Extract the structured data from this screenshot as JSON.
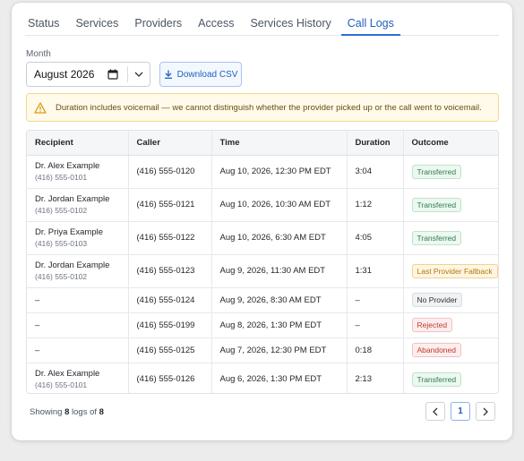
{
  "tabs": [
    {
      "label": "Status"
    },
    {
      "label": "Services"
    },
    {
      "label": "Providers"
    },
    {
      "label": "Access"
    },
    {
      "label": "Services History"
    },
    {
      "label": "Call Logs"
    }
  ],
  "active_tab": "Call Logs",
  "filters": {
    "month_label": "Month",
    "month_value": "August 2026",
    "download_label": "Download CSV"
  },
  "alert": {
    "text": "Duration includes voicemail — we cannot distinguish whether the provider picked up or the call went to voicemail.",
    "icon": "warning-icon"
  },
  "table": {
    "headers": [
      "Recipient",
      "Caller",
      "Time",
      "Duration",
      "Outcome"
    ],
    "rows": [
      {
        "recipient_name": "Dr. Alex Example",
        "recipient_phone": "(416) 555-0101",
        "caller": "(416) 555-0120",
        "time": "Aug 10, 2026, 12:30 PM EDT",
        "duration": "3:04",
        "outcome": "Transferred"
      },
      {
        "recipient_name": "Dr. Jordan Example",
        "recipient_phone": "(416) 555-0102",
        "caller": "(416) 555-0121",
        "time": "Aug 10, 2026, 10:30 AM EDT",
        "duration": "1:12",
        "outcome": "Transferred"
      },
      {
        "recipient_name": "Dr. Priya Example",
        "recipient_phone": "(416) 555-0103",
        "caller": "(416) 555-0122",
        "time": "Aug 10, 2026, 6:30 AM EDT",
        "duration": "4:05",
        "outcome": "Transferred"
      },
      {
        "recipient_name": "Dr. Jordan Example",
        "recipient_phone": "(416) 555-0102",
        "caller": "(416) 555-0123",
        "time": "Aug 9, 2026, 11:30 AM EDT",
        "duration": "1:31",
        "outcome": "Last Provider Fallback"
      },
      {
        "recipient_name": "–",
        "recipient_phone": "",
        "caller": "(416) 555-0124",
        "time": "Aug 9, 2026, 8:30 AM EDT",
        "duration": "–",
        "outcome": "No Provider"
      },
      {
        "recipient_name": "–",
        "recipient_phone": "",
        "caller": "(416) 555-0199",
        "time": "Aug 8, 2026, 1:30 PM EDT",
        "duration": "–",
        "outcome": "Rejected"
      },
      {
        "recipient_name": "–",
        "recipient_phone": "",
        "caller": "(416) 555-0125",
        "time": "Aug 7, 2026, 12:30 PM EDT",
        "duration": "0:18",
        "outcome": "Abandoned"
      },
      {
        "recipient_name": "Dr. Alex Example",
        "recipient_phone": "(416) 555-0101",
        "caller": "(416) 555-0126",
        "time": "Aug 6, 2026, 1:30 PM EDT",
        "duration": "2:13",
        "outcome": "Transferred"
      }
    ]
  },
  "footer": {
    "prefix": "Showing",
    "shown": "8",
    "middle": "logs of",
    "total": "8"
  },
  "pagination": {
    "prev_icon": "chevron-left-icon",
    "current_page": "1",
    "next_icon": "chevron-right-icon"
  },
  "colors": {
    "accent": "#2f6fd6",
    "warning_bg": "#fffaea",
    "transferred": "#2e7d4f",
    "fallback": "#b4740e",
    "rejected": "#c0392b"
  }
}
